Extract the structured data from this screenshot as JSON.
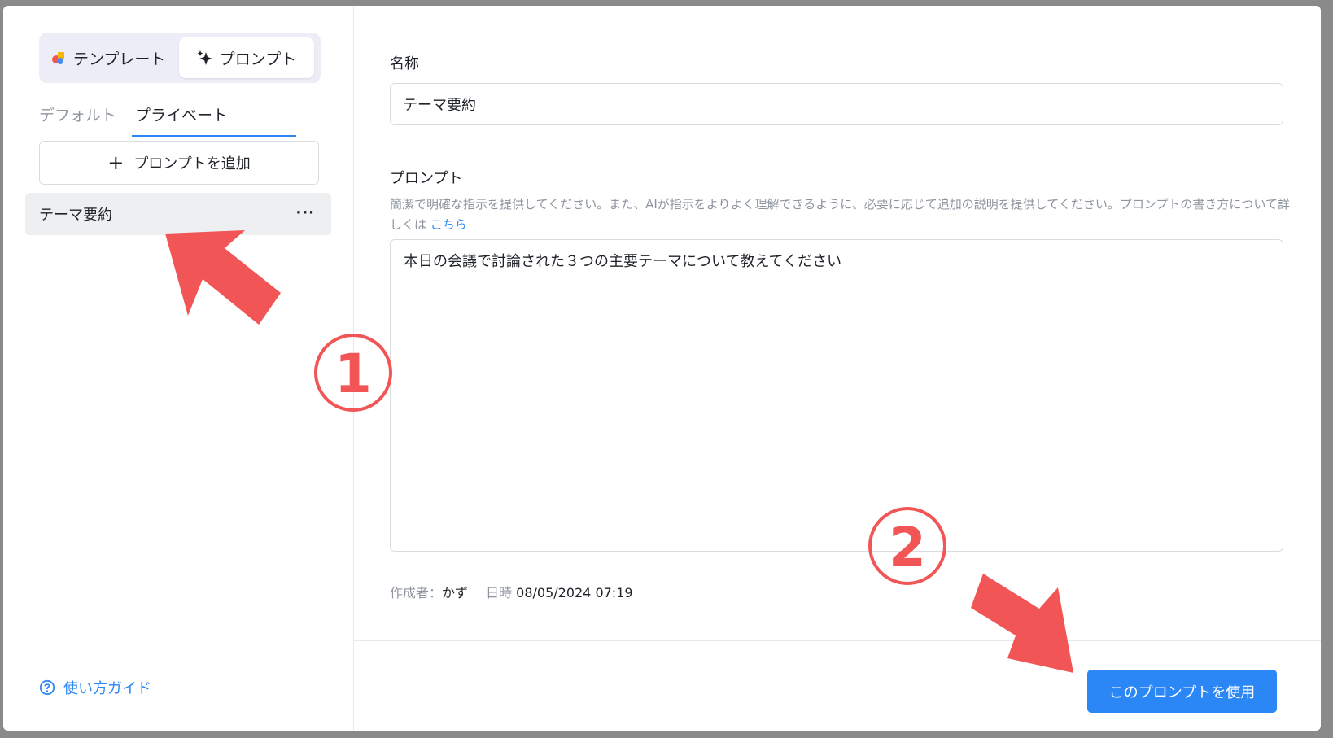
{
  "sidebar": {
    "mode_switch": {
      "templates_label": "テンプレート",
      "prompts_label": "プロンプト"
    },
    "tabs": {
      "default_label": "デフォルト",
      "private_label": "プライベート"
    },
    "add_button_label": "プロンプトを追加",
    "items": [
      {
        "label": "テーマ要約",
        "more": "···"
      }
    ],
    "guide_label": "使い方ガイド"
  },
  "form": {
    "name_label": "名称",
    "name_value": "テーマ要約",
    "prompt_label": "プロンプト",
    "hint_text": "簡潔で明確な指示を提供してください。また、AIが指示をよりよく理解できるように、必要に応じて追加の説明を提供してください。プロンプトの書き方について詳しくは",
    "hint_link": "こちら",
    "prompt_value": "本日の会議で討論された３つの主要テーマについて教えてください",
    "creator_label": "作成者：",
    "creator_value": "かず",
    "date_label": "日時",
    "date_value": "08/05/2024 07:19"
  },
  "footer": {
    "use_button_label": "このプロンプトを使用"
  },
  "annotations": {
    "step1": "①",
    "step2": "②"
  },
  "colors": {
    "accent": "#2b87f6",
    "annotation_red": "#f25555"
  }
}
